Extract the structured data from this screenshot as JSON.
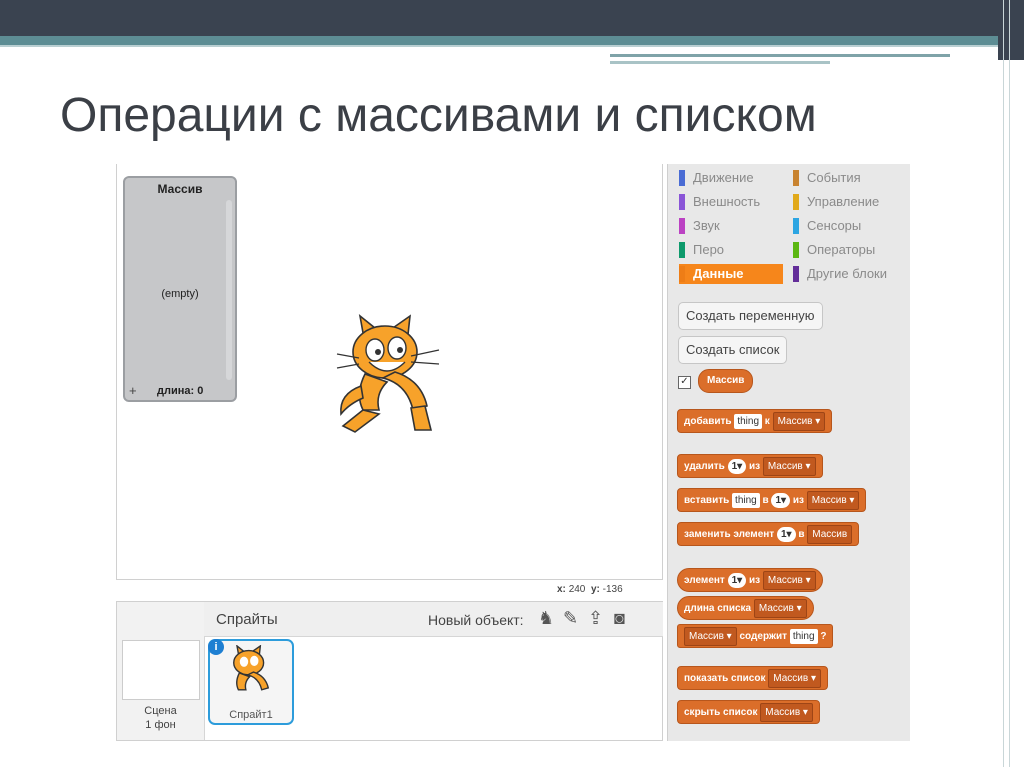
{
  "slide": {
    "title": "Операции с массивами и списком"
  },
  "stage": {
    "list_monitor": {
      "title": "Массив",
      "empty_text": "(empty)",
      "length_label": "длина: 0",
      "add_symbol": "+"
    },
    "coords": {
      "x_label": "x:",
      "x_value": "240",
      "y_label": "y:",
      "y_value": "-136"
    }
  },
  "sprites_pane": {
    "title": "Спрайты",
    "new_object_label": "Новый объект:",
    "scene_label": "Сцена",
    "scene_backdrops": "1 фон",
    "sprite_name": "Спрайт1",
    "info_symbol": "i"
  },
  "palette": {
    "categories": [
      {
        "label": "Движение",
        "color": "#4a6cd4"
      },
      {
        "label": "События",
        "color": "#c88330"
      },
      {
        "label": "Внешность",
        "color": "#8a55d7"
      },
      {
        "label": "Управление",
        "color": "#e1a91a"
      },
      {
        "label": "Звук",
        "color": "#bb42c3"
      },
      {
        "label": "Сенсоры",
        "color": "#2ca5e2"
      },
      {
        "label": "Перо",
        "color": "#0e9a6c"
      },
      {
        "label": "Операторы",
        "color": "#5cb712"
      },
      {
        "label": "Данные",
        "color": "#ee7d16"
      },
      {
        "label": "Другие блоки",
        "color": "#632d99"
      }
    ],
    "make_variable": "Создать переменную",
    "make_list": "Создать список",
    "list_reporter": "Массив",
    "blocks": {
      "add": {
        "w1": "добавить",
        "arg": "thing",
        "w2": "к",
        "list": "Массив"
      },
      "delete": {
        "w1": "удалить",
        "arg": "1",
        "w2": "из",
        "list": "Массив"
      },
      "insert": {
        "w1": "вставить",
        "arg": "thing",
        "w2": "в",
        "arg2": "1",
        "w3": "из",
        "list": "Массив"
      },
      "replace": {
        "w1": "заменить элемент",
        "arg": "1",
        "w2": "в",
        "list": "Массив"
      },
      "item": {
        "w1": "элемент",
        "arg": "1",
        "w2": "из",
        "list": "Массив"
      },
      "length": {
        "w1": "длина списка",
        "list": "Массив"
      },
      "contains": {
        "list": "Массив",
        "w1": "содержит",
        "arg": "thing",
        "q": "?"
      },
      "show": {
        "w1": "показать список",
        "list": "Массив"
      },
      "hide": {
        "w1": "скрыть список",
        "list": "Массив"
      }
    }
  },
  "colors": {
    "data_block": "#db6e2a",
    "selected_category": "#f6861b",
    "sprite_border": "#2d9cdb"
  }
}
